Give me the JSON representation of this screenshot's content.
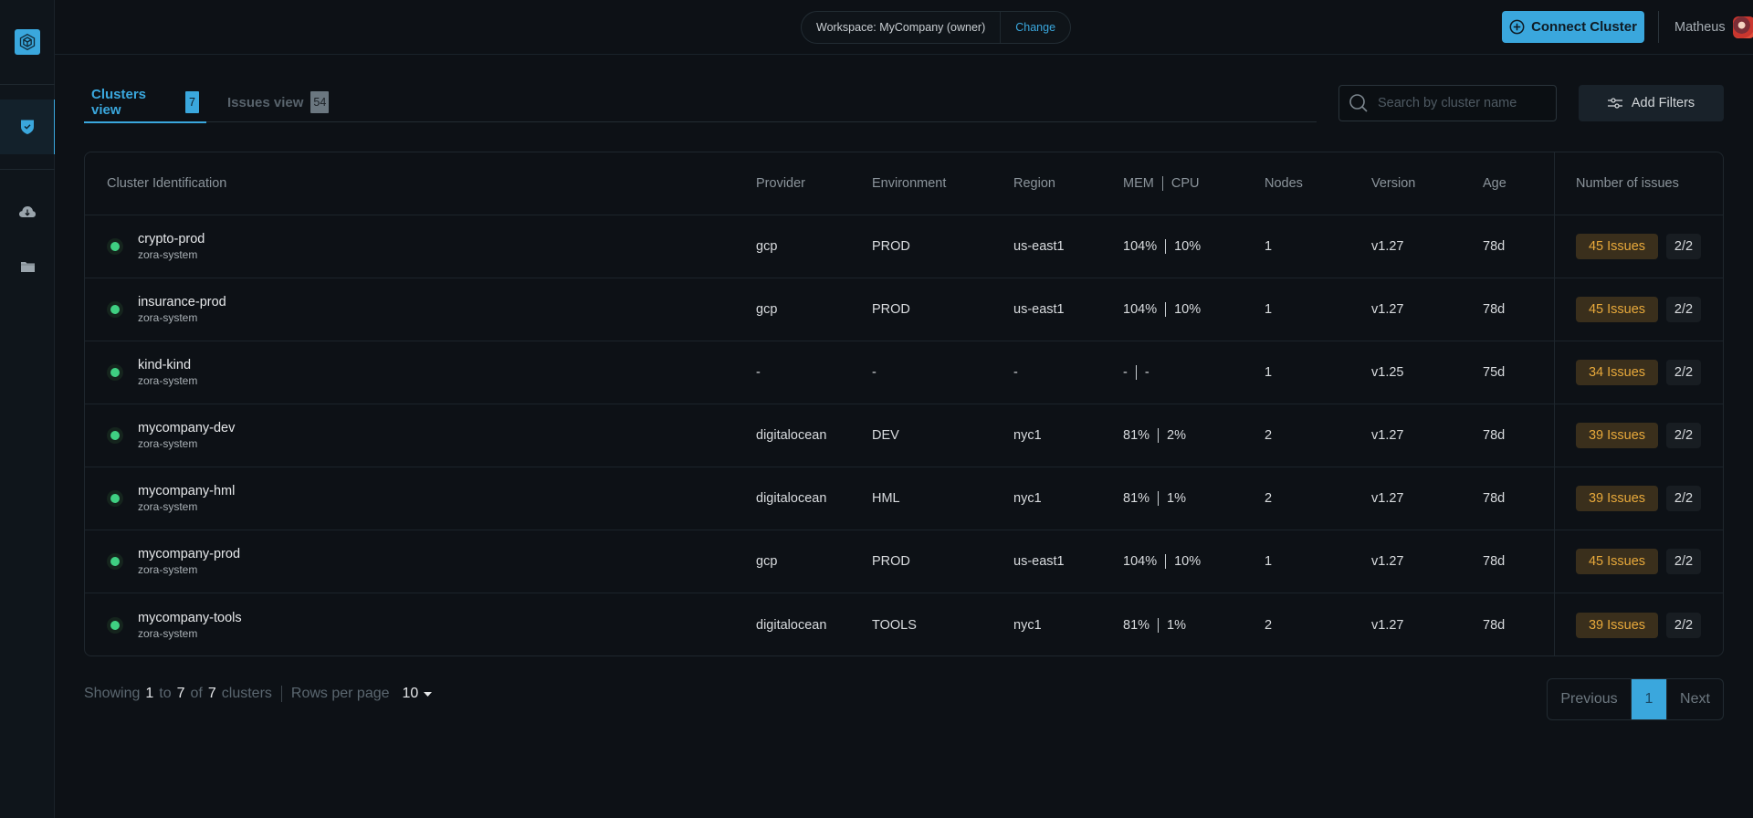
{
  "topbar": {
    "workspace_label": "Workspace: MyCompany (owner)",
    "workspace_change": "Change",
    "connect_button": "Connect Cluster",
    "user_name": "Matheus"
  },
  "sidebar": {
    "items": [
      {
        "icon": "shield-check-icon",
        "active": true
      },
      {
        "icon": "cloud-download-icon",
        "active": false
      },
      {
        "icon": "folder-icon",
        "active": false
      }
    ]
  },
  "tabs": [
    {
      "label": "Clusters view",
      "count": "7",
      "active": true
    },
    {
      "label": "Issues view",
      "count": "54",
      "active": false
    }
  ],
  "search": {
    "placeholder": "Search by cluster name",
    "value": ""
  },
  "filters_button": "Add Filters",
  "table": {
    "headers": {
      "cluster": "Cluster Identification",
      "provider": "Provider",
      "environment": "Environment",
      "region": "Region",
      "mem": "MEM",
      "cpu": "CPU",
      "nodes": "Nodes",
      "version": "Version",
      "age": "Age",
      "issues": "Number of issues"
    },
    "rows": [
      {
        "name": "crypto-prod",
        "namespace": "zora-system",
        "provider": "gcp",
        "environment": "PROD",
        "region": "us-east1",
        "mem": "104%",
        "cpu": "10%",
        "nodes": "1",
        "version": "v1.27",
        "age": "78d",
        "issues": "45 Issues",
        "ratio": "2/2",
        "status": "healthy"
      },
      {
        "name": "insurance-prod",
        "namespace": "zora-system",
        "provider": "gcp",
        "environment": "PROD",
        "region": "us-east1",
        "mem": "104%",
        "cpu": "10%",
        "nodes": "1",
        "version": "v1.27",
        "age": "78d",
        "issues": "45 Issues",
        "ratio": "2/2",
        "status": "healthy"
      },
      {
        "name": "kind-kind",
        "namespace": "zora-system",
        "provider": "-",
        "environment": "-",
        "region": "-",
        "mem": "-",
        "cpu": "-",
        "nodes": "1",
        "version": "v1.25",
        "age": "75d",
        "issues": "34 Issues",
        "ratio": "2/2",
        "status": "healthy"
      },
      {
        "name": "mycompany-dev",
        "namespace": "zora-system",
        "provider": "digitalocean",
        "environment": "DEV",
        "region": "nyc1",
        "mem": "81%",
        "cpu": "2%",
        "nodes": "2",
        "version": "v1.27",
        "age": "78d",
        "issues": "39 Issues",
        "ratio": "2/2",
        "status": "healthy"
      },
      {
        "name": "mycompany-hml",
        "namespace": "zora-system",
        "provider": "digitalocean",
        "environment": "HML",
        "region": "nyc1",
        "mem": "81%",
        "cpu": "1%",
        "nodes": "2",
        "version": "v1.27",
        "age": "78d",
        "issues": "39 Issues",
        "ratio": "2/2",
        "status": "healthy"
      },
      {
        "name": "mycompany-prod",
        "namespace": "zora-system",
        "provider": "gcp",
        "environment": "PROD",
        "region": "us-east1",
        "mem": "104%",
        "cpu": "10%",
        "nodes": "1",
        "version": "v1.27",
        "age": "78d",
        "issues": "45 Issues",
        "ratio": "2/2",
        "status": "healthy"
      },
      {
        "name": "mycompany-tools",
        "namespace": "zora-system",
        "provider": "digitalocean",
        "environment": "TOOLS",
        "region": "nyc1",
        "mem": "81%",
        "cpu": "1%",
        "nodes": "2",
        "version": "v1.27",
        "age": "78d",
        "issues": "39 Issues",
        "ratio": "2/2",
        "status": "healthy"
      }
    ]
  },
  "footer": {
    "showing": "Showing",
    "from": "1",
    "to_word": "to",
    "to": "7",
    "of_word": "of",
    "total": "7",
    "unit": "clusters",
    "rows_per_page_label": "Rows per page",
    "rows_per_page": "10",
    "pagination": {
      "previous": "Previous",
      "current": "1",
      "next": "Next"
    }
  },
  "colors": {
    "accent": "#3aa7dd",
    "status_ok": "#3fcf82",
    "issues_text": "#e8a93b",
    "background": "#0d1116"
  }
}
